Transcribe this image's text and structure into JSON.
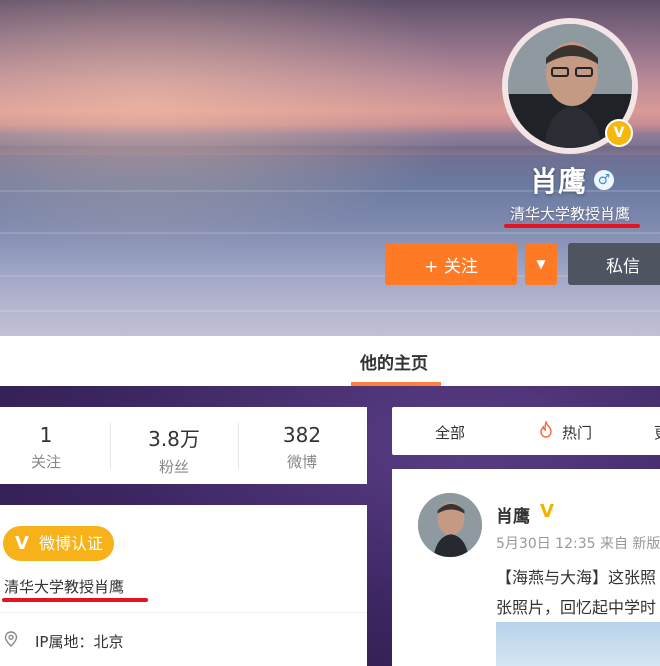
{
  "profile": {
    "name": "肖鹰",
    "gender_symbol": "♂",
    "bio": "清华大学教授肖鹰",
    "verified_mark": "V"
  },
  "actions": {
    "follow_label": "关注",
    "follow_icon": "+",
    "more_icon": "▼",
    "message_label": "私信"
  },
  "tabs": {
    "home": "他的主页"
  },
  "stats": [
    {
      "value": "1",
      "label": "关注"
    },
    {
      "value": "3.8万",
      "label": "粉丝"
    },
    {
      "value": "382",
      "label": "微博"
    }
  ],
  "info": {
    "verified_badge": "微博认证",
    "verified_title": "清华大学教授肖鹰",
    "ip_location": "IP属地：北京"
  },
  "feed_filter": {
    "all": "全部",
    "hot": "热门",
    "more": "更"
  },
  "post": {
    "author": "肖鹰",
    "meta": "5月30日 12:35 来自 新版",
    "text_line1": "【海燕与大海】这张照",
    "text_line2": "张照片，回忆起中学时"
  },
  "colors": {
    "accent_orange": "#ff7a24",
    "verified_gold": "#f7b21a",
    "highlight_red": "#e3131f",
    "message_button": "#4e5561"
  }
}
